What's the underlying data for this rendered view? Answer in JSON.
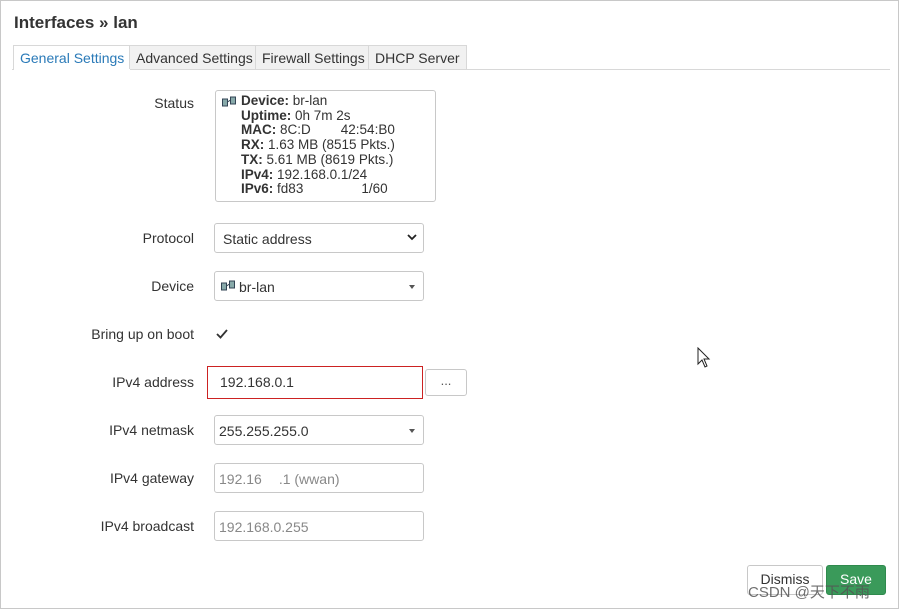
{
  "page": {
    "title": "Interfaces » lan"
  },
  "tabs": [
    {
      "label": "General Settings",
      "active": true
    },
    {
      "label": "Advanced Settings",
      "active": false
    },
    {
      "label": "Firewall Settings",
      "active": false
    },
    {
      "label": "DHCP Server",
      "active": false
    }
  ],
  "status": {
    "label": "Status",
    "icon": "network-bridge-icon",
    "device": {
      "key": "Device:",
      "value": "br-lan"
    },
    "uptime": {
      "key": "Uptime:",
      "value": "0h 7m 2s"
    },
    "mac": {
      "key": "MAC:",
      "value": "8C:D"
    },
    "mac_tail": "42:54:B0",
    "rx": {
      "key": "RX:",
      "value": "1.63 MB (8515 Pkts.)"
    },
    "tx": {
      "key": "TX:",
      "value": "5.61 MB (8619 Pkts.)"
    },
    "ipv4": {
      "key": "IPv4:",
      "value": "192.168.0.1/24"
    },
    "ipv6": {
      "key": "IPv6:",
      "value": "fd83"
    },
    "ipv6_tail": "1/60"
  },
  "form": {
    "protocol": {
      "label": "Protocol",
      "value": "Static address"
    },
    "device": {
      "label": "Device",
      "value": "br-lan",
      "icon": "network-bridge-icon"
    },
    "boot": {
      "label": "Bring up on boot",
      "checked": true
    },
    "ipv4_address": {
      "label": "IPv4 address",
      "value": "192.168.0.1",
      "more_label": "..."
    },
    "ipv4_netmask": {
      "label": "IPv4 netmask",
      "value": "255.255.255.0"
    },
    "ipv4_gateway": {
      "label": "IPv4 gateway",
      "placeholder": "192.16",
      "placeholder_tail": ".1 (wwan)"
    },
    "ipv4_broadcast": {
      "label": "IPv4 broadcast",
      "placeholder": "192.168.0.255"
    }
  },
  "actions": {
    "dismiss": "Dismiss",
    "save": "Save"
  },
  "watermark": "CSDN @天下不雨",
  "colors": {
    "accent": "#2a7ab8",
    "save": "#3a9a5a",
    "highlight": "#cc2222"
  }
}
